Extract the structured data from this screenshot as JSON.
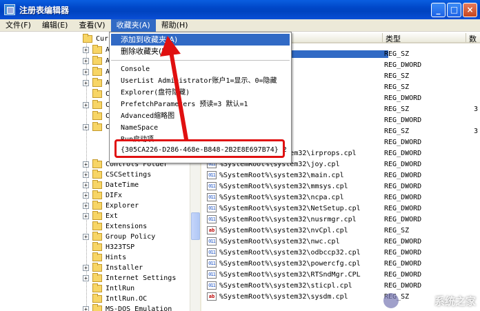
{
  "window": {
    "title": "注册表编辑器",
    "minimize": "_",
    "maximize": "□",
    "close": "×"
  },
  "menubar": [
    {
      "label": "文件(F)"
    },
    {
      "label": "编辑(E)"
    },
    {
      "label": "查看(V)"
    },
    {
      "label": "收藏夹(A)"
    },
    {
      "label": "帮助(H)"
    }
  ],
  "tree": {
    "root_partial": "Curr",
    "partial_rows": [
      "A",
      "A",
      "A",
      "A",
      "C",
      "C",
      "C",
      "C"
    ],
    "rows": [
      "Controls Folder",
      "CSCSettings",
      "DateTime",
      "DIFx",
      "Explorer",
      "Ext",
      "Extensions",
      "Group Policy",
      "H323TSP",
      "Hints",
      "Installer",
      "Internet Settings",
      "IntlRun",
      "IntlRun.OC",
      "MS-DOS Emulation"
    ]
  },
  "list": {
    "header_type": "类型",
    "header_data": "数",
    "rows": [
      {
        "name": "32\\access.cpl",
        "type": "REG_SZ",
        "data": "",
        "kind": "sz",
        "selected": true
      },
      {
        "name": "32\\ALSNDMGR.CPL",
        "type": "REG_DWORD",
        "data": "",
        "kind": "dword"
      },
      {
        "name": "32\\appwiz.cpl",
        "type": "REG_SZ",
        "data": "",
        "kind": "sz"
      },
      {
        "name": "32\\bthprops.cpl",
        "type": "REG_SZ",
        "data": "",
        "kind": "sz"
      },
      {
        "name": "32\\desk.cpl",
        "type": "REG_DWORD",
        "data": "",
        "kind": "dword"
      },
      {
        "name": "32\\Firewall.cpl",
        "type": "REG_SZ",
        "data": "3",
        "kind": "sz"
      },
      {
        "name": "32\\hdwwiz.cpl",
        "type": "REG_DWORD",
        "data": "",
        "kind": "dword"
      },
      {
        "name": "32\\inetcpl.cpl",
        "type": "REG_SZ",
        "data": "3",
        "kind": "sz"
      },
      {
        "name": "32\\intl.cpl",
        "type": "REG_DWORD",
        "data": "",
        "kind": "dword"
      },
      {
        "name": "%SystemRoot%\\system32\\irprops.cpl",
        "type": "REG_DWORD",
        "data": "",
        "kind": "dword"
      },
      {
        "name": "%SystemRoot%\\system32\\joy.cpl",
        "type": "REG_DWORD",
        "data": "",
        "kind": "dword"
      },
      {
        "name": "%SystemRoot%\\system32\\main.cpl",
        "type": "REG_DWORD",
        "data": "",
        "kind": "dword"
      },
      {
        "name": "%SystemRoot%\\system32\\mmsys.cpl",
        "type": "REG_DWORD",
        "data": "",
        "kind": "dword"
      },
      {
        "name": "%SystemRoot%\\system32\\ncpa.cpl",
        "type": "REG_DWORD",
        "data": "",
        "kind": "dword"
      },
      {
        "name": "%SystemRoot%\\system32\\NetSetup.cpl",
        "type": "REG_DWORD",
        "data": "",
        "kind": "dword"
      },
      {
        "name": "%SystemRoot%\\system32\\nusrmgr.cpl",
        "type": "REG_DWORD",
        "data": "",
        "kind": "dword"
      },
      {
        "name": "%SystemRoot%\\system32\\nvCpl.cpl",
        "type": "REG_SZ",
        "data": "",
        "kind": "sz"
      },
      {
        "name": "%SystemRoot%\\system32\\nwc.cpl",
        "type": "REG_DWORD",
        "data": "",
        "kind": "dword"
      },
      {
        "name": "%SystemRoot%\\system32\\odbccp32.cpl",
        "type": "REG_DWORD",
        "data": "",
        "kind": "dword"
      },
      {
        "name": "%SystemRoot%\\system32\\powercfg.cpl",
        "type": "REG_DWORD",
        "data": "",
        "kind": "dword"
      },
      {
        "name": "%SystemRoot%\\system32\\RTSndMgr.CPL",
        "type": "REG_DWORD",
        "data": "",
        "kind": "dword"
      },
      {
        "name": "%SystemRoot%\\system32\\sticpl.cpl",
        "type": "REG_DWORD",
        "data": "",
        "kind": "dword"
      },
      {
        "name": "%SystemRoot%\\system32\\sysdm.cpl",
        "type": "REG_SZ",
        "data": "",
        "kind": "sz"
      }
    ]
  },
  "dropdown": {
    "add_favorite": "添加到收藏夹(A)",
    "remove_favorite": "删除收藏夹(R)",
    "items": [
      "Console",
      "UserList Administrator账户1=显示、0=隐藏",
      "Explorer(盘符隐藏)",
      "PrefetchParameters 预读=3 默认=1",
      "Advanced缩略图",
      "NameSpace",
      "Run启动项"
    ],
    "highlighted_favorite": "{305CA226-D286-468e-B848-2B2E8E697B74} 2"
  },
  "watermark": "系统之家",
  "colors": {
    "annotation": "#e01010",
    "selection": "#316ac5",
    "titlebar": "#0047c8"
  }
}
